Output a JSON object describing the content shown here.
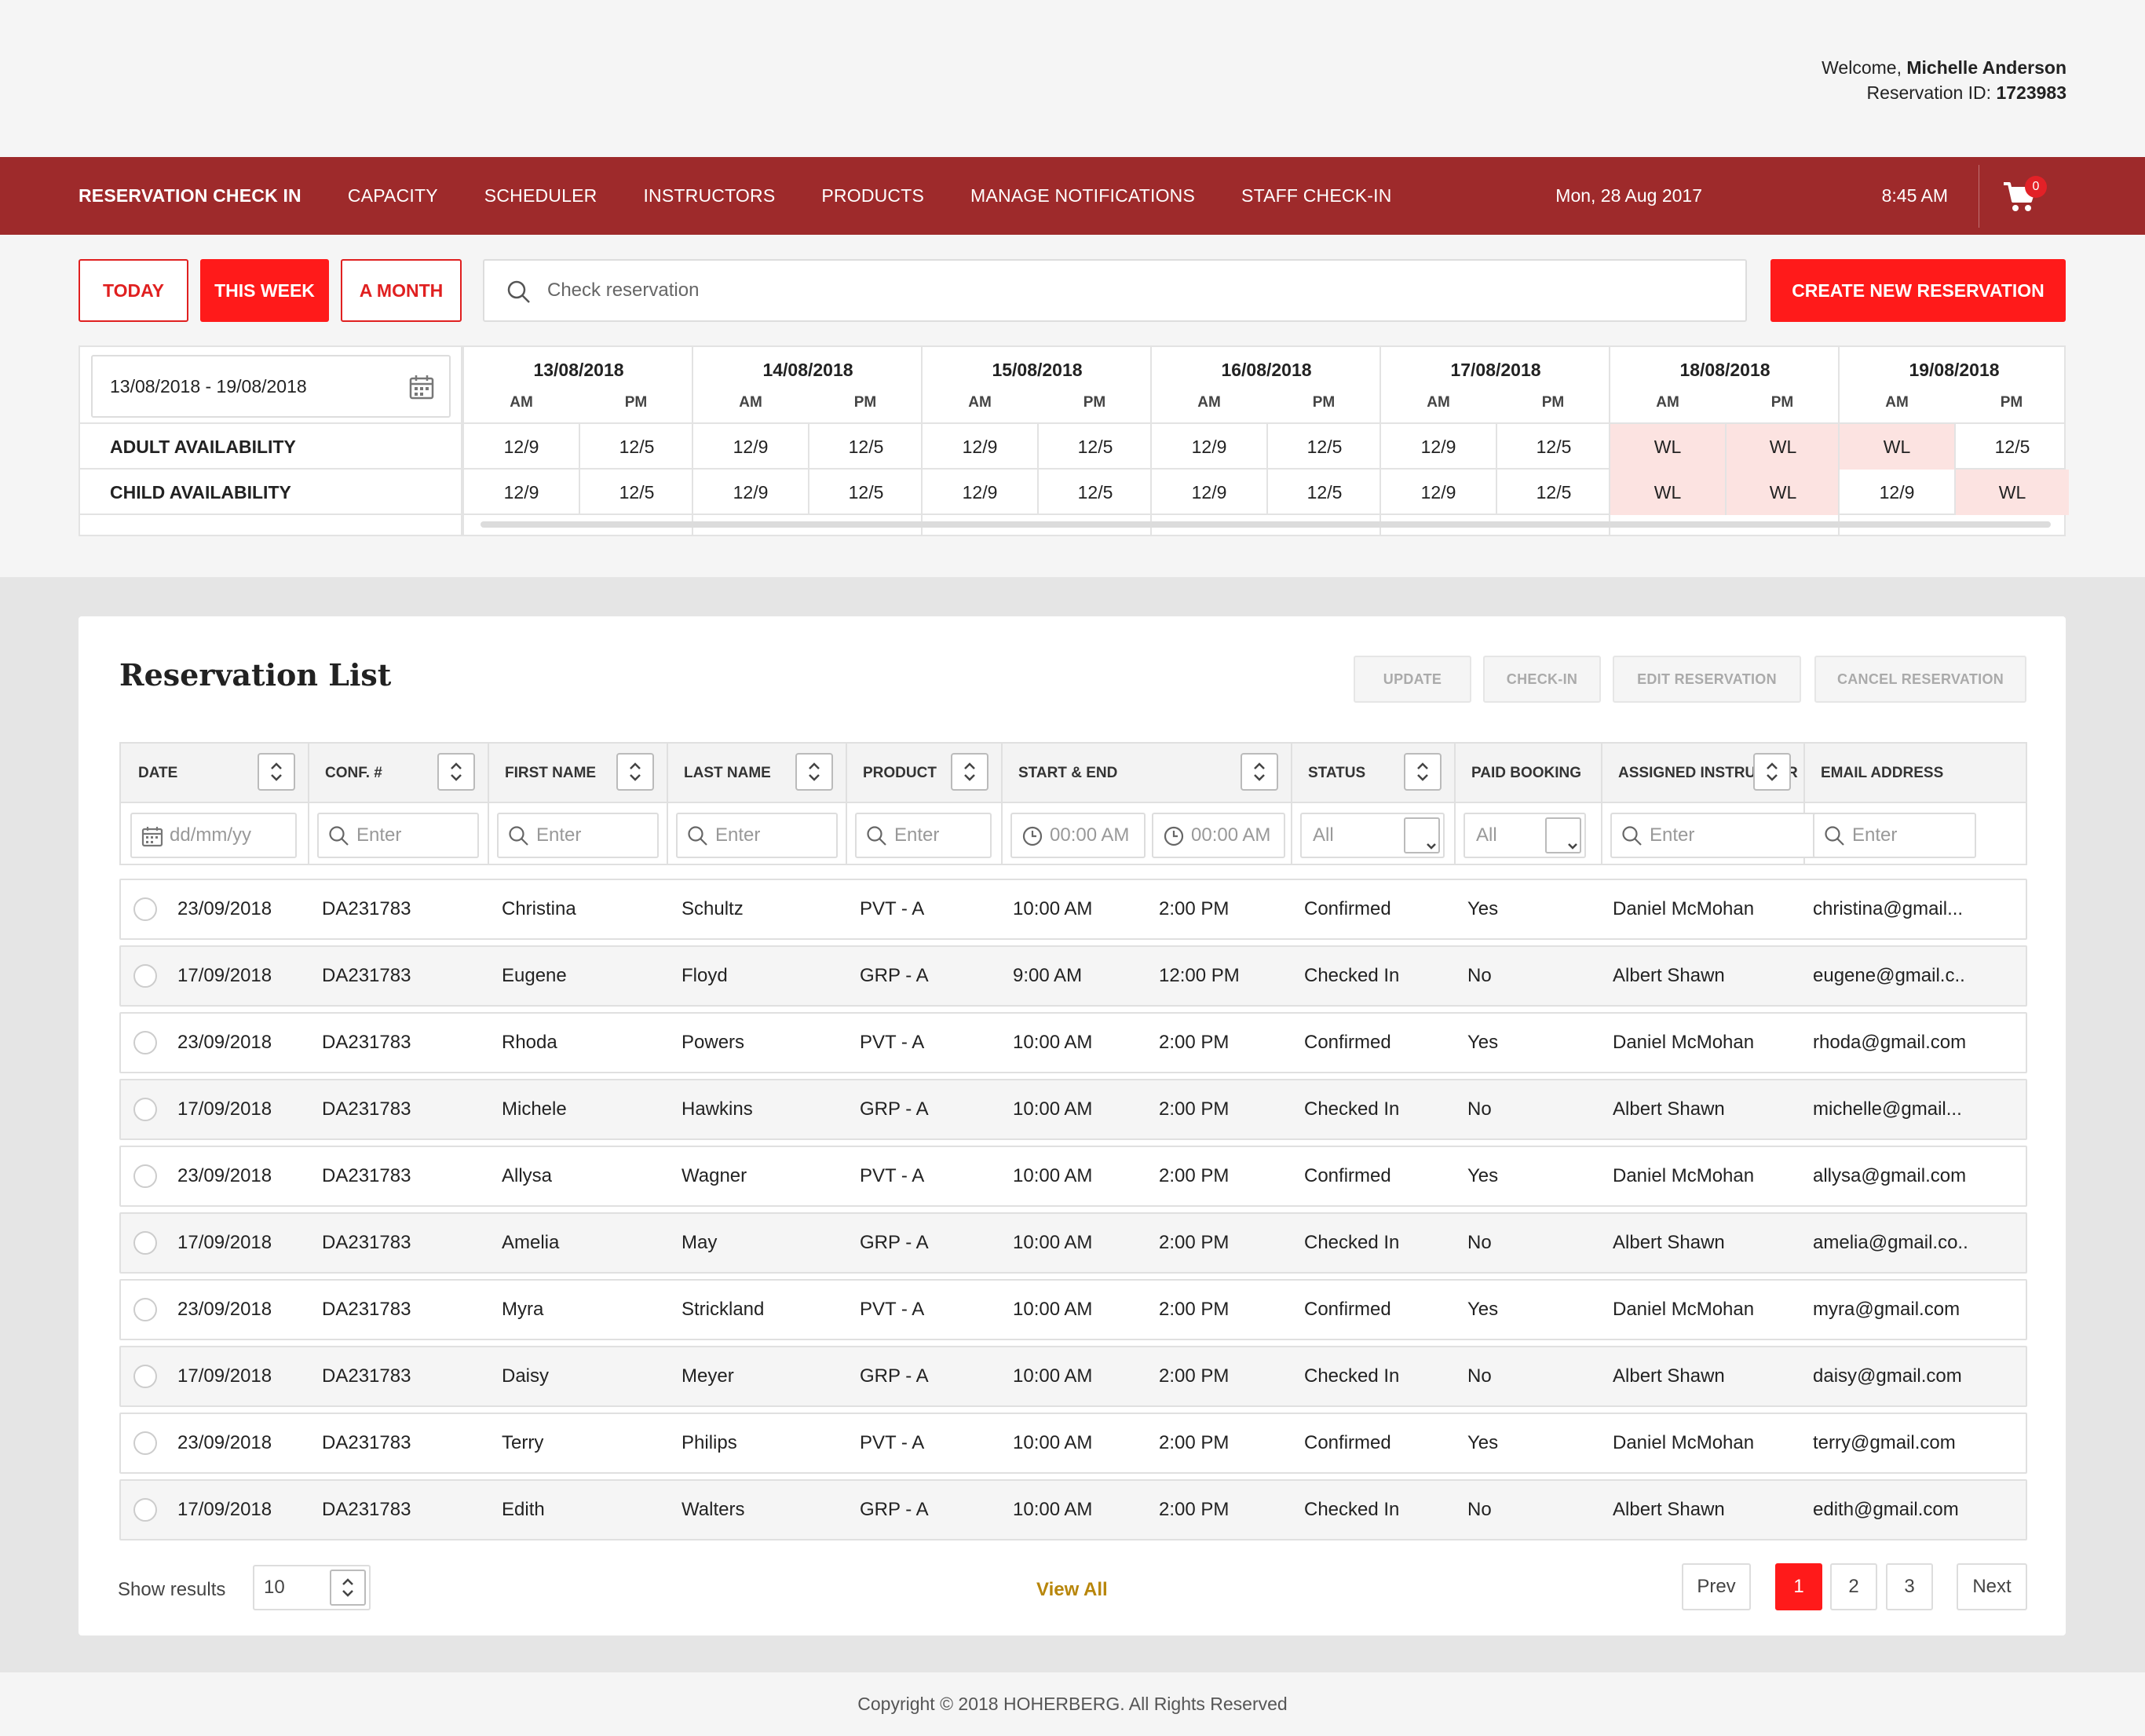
{
  "header": {
    "welcome_prefix": "Welcome,",
    "user_name": "Michelle Anderson",
    "reservation_prefix": "Reservation ID:",
    "reservation_id": "1723983"
  },
  "nav": {
    "items": [
      "RESERVATION CHECK IN",
      "CAPACITY",
      "SCHEDULER",
      "INSTRUCTORS",
      "PRODUCTS",
      "MANAGE NOTIFICATIONS",
      "STAFF CHECK-IN"
    ],
    "date": "Mon, 28 Aug 2017",
    "time": "8:45 AM",
    "cart_count": "0"
  },
  "filters": {
    "today": "TODAY",
    "this_week": "THIS WEEK",
    "a_month": "A MONTH",
    "search_placeholder": "Check reservation",
    "create_button": "CREATE NEW RESERVATION"
  },
  "availability": {
    "date_range": "13/08/2018 - 19/08/2018",
    "adult_label": "ADULT AVAILABILITY",
    "child_label": "CHILD AVAILABILITY",
    "am": "AM",
    "pm": "PM",
    "days": [
      {
        "date": "13/08/2018",
        "adult": [
          "12/9",
          "12/5"
        ],
        "child": [
          "12/9",
          "12/5"
        ]
      },
      {
        "date": "14/08/2018",
        "adult": [
          "12/9",
          "12/5"
        ],
        "child": [
          "12/9",
          "12/5"
        ]
      },
      {
        "date": "15/08/2018",
        "adult": [
          "12/9",
          "12/5"
        ],
        "child": [
          "12/9",
          "12/5"
        ]
      },
      {
        "date": "16/08/2018",
        "adult": [
          "12/9",
          "12/5"
        ],
        "child": [
          "12/9",
          "12/5"
        ]
      },
      {
        "date": "17/08/2018",
        "adult": [
          "12/9",
          "12/5"
        ],
        "child": [
          "12/9",
          "12/5"
        ]
      },
      {
        "date": "18/08/2018",
        "adult": [
          "WL",
          "WL"
        ],
        "child": [
          "WL",
          "WL"
        ]
      },
      {
        "date": "19/08/2018",
        "adult": [
          "WL",
          "12/5"
        ],
        "child": [
          "12/9",
          "WL"
        ]
      }
    ]
  },
  "list": {
    "title": "Reservation List",
    "actions": [
      "UPDATE",
      "CHECK-IN",
      "EDIT RESERVATION",
      "CANCEL RESERVATION"
    ],
    "columns": [
      "DATE",
      "CONF. #",
      "FIRST NAME",
      "LAST NAME",
      "PRODUCT",
      "START & END",
      "STATUS",
      "PAID BOOKING",
      "ASSIGNED INSTRUCTOR",
      "EMAIL ADDRESS"
    ],
    "filters": {
      "date_placeholder": "dd/mm/yy",
      "enter": "Enter",
      "time_placeholder": "00:00 AM",
      "all": "All"
    },
    "rows": [
      {
        "date": "23/09/2018",
        "conf": "DA231783",
        "first": "Christina",
        "last": "Schultz",
        "product": "PVT - A",
        "start": "10:00 AM",
        "end": "2:00 PM",
        "status": "Confirmed",
        "paid": "Yes",
        "instructor": "Daniel McMohan",
        "email": "christina@gmail..."
      },
      {
        "date": "17/09/2018",
        "conf": "DA231783",
        "first": "Eugene",
        "last": "Floyd",
        "product": "GRP - A",
        "start": "9:00 AM",
        "end": "12:00 PM",
        "status": "Checked In",
        "paid": "No",
        "instructor": "Albert Shawn",
        "email": "eugene@gmail.c.."
      },
      {
        "date": "23/09/2018",
        "conf": "DA231783",
        "first": "Rhoda",
        "last": "Powers",
        "product": "PVT - A",
        "start": "10:00 AM",
        "end": "2:00 PM",
        "status": "Confirmed",
        "paid": "Yes",
        "instructor": "Daniel McMohan",
        "email": "rhoda@gmail.com"
      },
      {
        "date": "17/09/2018",
        "conf": "DA231783",
        "first": "Michele",
        "last": "Hawkins",
        "product": "GRP - A",
        "start": "10:00 AM",
        "end": "2:00 PM",
        "status": "Checked In",
        "paid": "No",
        "instructor": "Albert Shawn",
        "email": "michelle@gmail..."
      },
      {
        "date": "23/09/2018",
        "conf": "DA231783",
        "first": "Allysa",
        "last": "Wagner",
        "product": "PVT - A",
        "start": "10:00 AM",
        "end": "2:00 PM",
        "status": "Confirmed",
        "paid": "Yes",
        "instructor": "Daniel McMohan",
        "email": "allysa@gmail.com"
      },
      {
        "date": "17/09/2018",
        "conf": "DA231783",
        "first": "Amelia",
        "last": "May",
        "product": "GRP - A",
        "start": "10:00 AM",
        "end": "2:00 PM",
        "status": "Checked In",
        "paid": "No",
        "instructor": "Albert Shawn",
        "email": "amelia@gmail.co.."
      },
      {
        "date": "23/09/2018",
        "conf": "DA231783",
        "first": "Myra",
        "last": "Strickland",
        "product": "PVT - A",
        "start": "10:00 AM",
        "end": "2:00 PM",
        "status": "Confirmed",
        "paid": "Yes",
        "instructor": "Daniel McMohan",
        "email": "myra@gmail.com"
      },
      {
        "date": "17/09/2018",
        "conf": "DA231783",
        "first": "Daisy",
        "last": "Meyer",
        "product": "GRP - A",
        "start": "10:00 AM",
        "end": "2:00 PM",
        "status": "Checked In",
        "paid": "No",
        "instructor": "Albert Shawn",
        "email": "daisy@gmail.com"
      },
      {
        "date": "23/09/2018",
        "conf": "DA231783",
        "first": "Terry",
        "last": "Philips",
        "product": "PVT - A",
        "start": "10:00 AM",
        "end": "2:00 PM",
        "status": "Confirmed",
        "paid": "Yes",
        "instructor": "Daniel McMohan",
        "email": "terry@gmail.com"
      },
      {
        "date": "17/09/2018",
        "conf": "DA231783",
        "first": "Edith",
        "last": "Walters",
        "product": "GRP - A",
        "start": "10:00 AM",
        "end": "2:00 PM",
        "status": "Checked In",
        "paid": "No",
        "instructor": "Albert Shawn",
        "email": "edith@gmail.com"
      }
    ],
    "show_results_label": "Show results",
    "show_results_value": "10",
    "view_all": "View All",
    "pagination": {
      "prev": "Prev",
      "pages": [
        "1",
        "2",
        "3"
      ],
      "next": "Next",
      "current": "1"
    }
  },
  "footer": {
    "copyright": "Copyright © 2018 HOHERBERG. All Rights Reserved"
  },
  "colors": {
    "nav_bg": "#9e2a2b",
    "accent": "#ff1a1a",
    "waitlist_bg": "#fce3e1",
    "view_all": "#b8860b"
  }
}
